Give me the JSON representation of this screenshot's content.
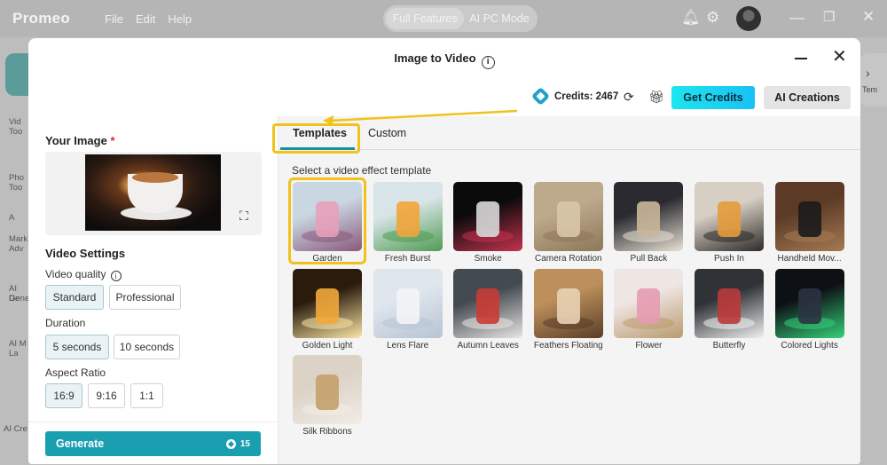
{
  "app": {
    "name": "Promeo",
    "menu": [
      "File",
      "Edit",
      "Help"
    ],
    "modes": [
      "Full Features",
      "AI PC Mode"
    ],
    "icons": [
      "bell-icon",
      "gear-icon",
      "minimize-icon",
      "maximize-icon",
      "close-icon"
    ]
  },
  "sidebar_remnants": [
    "Vid",
    "Too",
    "Pho",
    "Too",
    "A",
    "Mark",
    "Adv",
    "AI De",
    "Gene",
    "AI M",
    "La",
    "AI Cre"
  ],
  "right_remnant": "Tem",
  "modal": {
    "title": "Image to Video",
    "credits_label": "Credits: 2467",
    "get_credits": "Get Credits",
    "ai_creations": "AI Creations"
  },
  "left": {
    "your_image": "Your Image",
    "required_mark": "*",
    "video_settings": "Video Settings",
    "video_quality_label": "Video quality",
    "quality_options": [
      "Standard",
      "Professional"
    ],
    "quality_selected": "Standard",
    "duration_label": "Duration",
    "duration_options": [
      "5 seconds",
      "10 seconds"
    ],
    "duration_selected": "5 seconds",
    "aspect_label": "Aspect Ratio",
    "aspect_options": [
      "16:9",
      "9:16",
      "1:1"
    ],
    "aspect_selected": "16:9",
    "generate_label": "Generate",
    "generate_cost": "15"
  },
  "right": {
    "tabs": [
      "Templates",
      "Custom"
    ],
    "active_tab": "Templates",
    "hint": "Select a video effect template",
    "templates": [
      {
        "label": "Garden",
        "selected": true,
        "colors": [
          "#c9d7e2",
          "#e7a0b9",
          "#8a5a7c"
        ]
      },
      {
        "label": "Fresh Burst",
        "colors": [
          "#d9e4e8",
          "#f2a43a",
          "#4f9b52"
        ]
      },
      {
        "label": "Smoke",
        "colors": [
          "#0b0b0b",
          "#d8d8d8",
          "#c4324f"
        ]
      },
      {
        "label": "Camera Rotation",
        "colors": [
          "#bda98c",
          "#d7c6a9",
          "#8e7759"
        ]
      },
      {
        "label": "Pull Back",
        "colors": [
          "#2a2a30",
          "#c9b79a",
          "#e8e1d4"
        ]
      },
      {
        "label": "Push In",
        "colors": [
          "#d8cfc4",
          "#e59b3c",
          "#2d2a28"
        ]
      },
      {
        "label": "Handheld Mov...",
        "colors": [
          "#5c3b26",
          "#1b1b1b",
          "#a57a52"
        ]
      },
      {
        "label": "Golden Light",
        "colors": [
          "#2a1b0d",
          "#f2a93a",
          "#fbe6a6"
        ]
      },
      {
        "label": "Lens Flare",
        "colors": [
          "#dfe6ee",
          "#f4f4f6",
          "#b8c4d4"
        ]
      },
      {
        "label": "Autumn Leaves",
        "colors": [
          "#444a52",
          "#c93b34",
          "#e9e6e2"
        ]
      },
      {
        "label": "Feathers Floating",
        "colors": [
          "#bc8f5c",
          "#e9d3b4",
          "#5a3d28"
        ]
      },
      {
        "label": "Flower",
        "colors": [
          "#efe6e4",
          "#e69bb1",
          "#b99a6e"
        ]
      },
      {
        "label": "Butterfly",
        "colors": [
          "#2f3236",
          "#ba3a3a",
          "#f0f0f0"
        ]
      },
      {
        "label": "Colored Lights",
        "colors": [
          "#0d1015",
          "#2a3340",
          "#35d07a"
        ]
      },
      {
        "label": "Silk Ribbons",
        "colors": [
          "#dcd2c6",
          "#c4a06a",
          "#f1ece6"
        ]
      }
    ]
  }
}
